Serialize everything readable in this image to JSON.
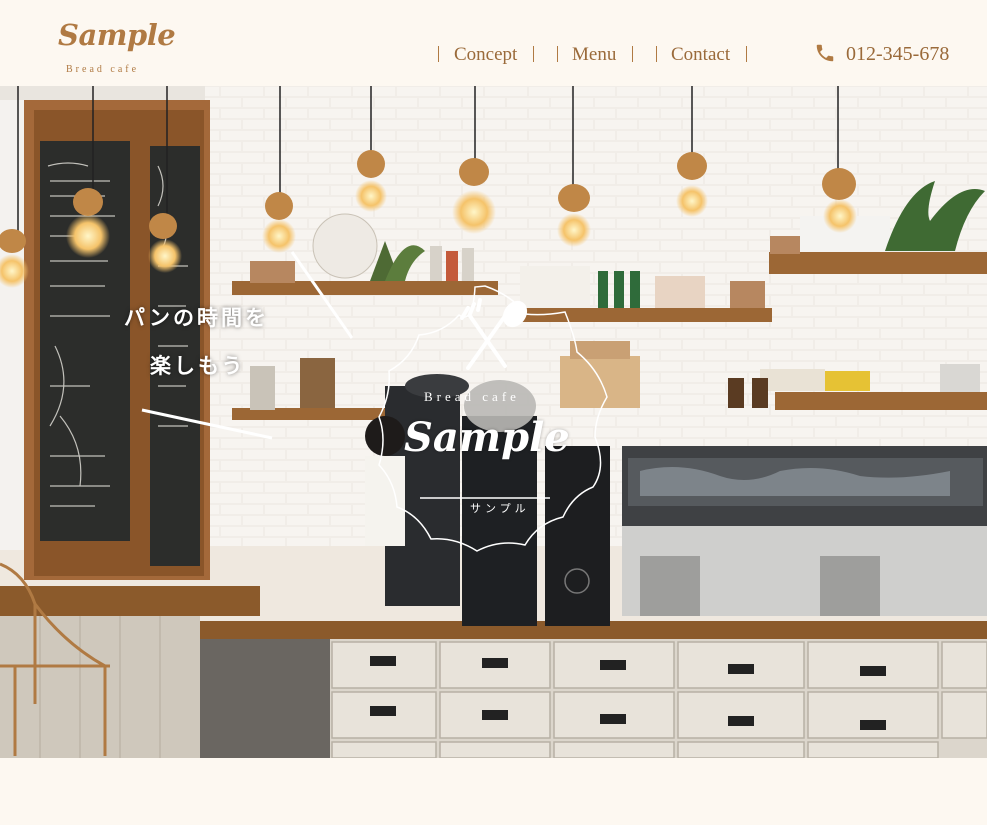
{
  "brand": {
    "logo_text": "Sample",
    "logo_subtitle": "Bread cafe"
  },
  "nav": {
    "items": [
      {
        "label": "Concept"
      },
      {
        "label": "Menu"
      },
      {
        "label": "Contact"
      }
    ]
  },
  "contact": {
    "phone": "012-345-678",
    "icon": "phone-icon"
  },
  "hero": {
    "catch_line1": "パンの時間を",
    "catch_line2": "楽しもう",
    "emblem_sub": "Bread cafe",
    "emblem_main": "Sample",
    "emblem_kana": "サンプル",
    "emblem_icon": "fork-spoon-icon"
  },
  "colors": {
    "accent": "#b07a43",
    "background": "#fdf8f1",
    "nav_text": "#9a6a3a"
  }
}
